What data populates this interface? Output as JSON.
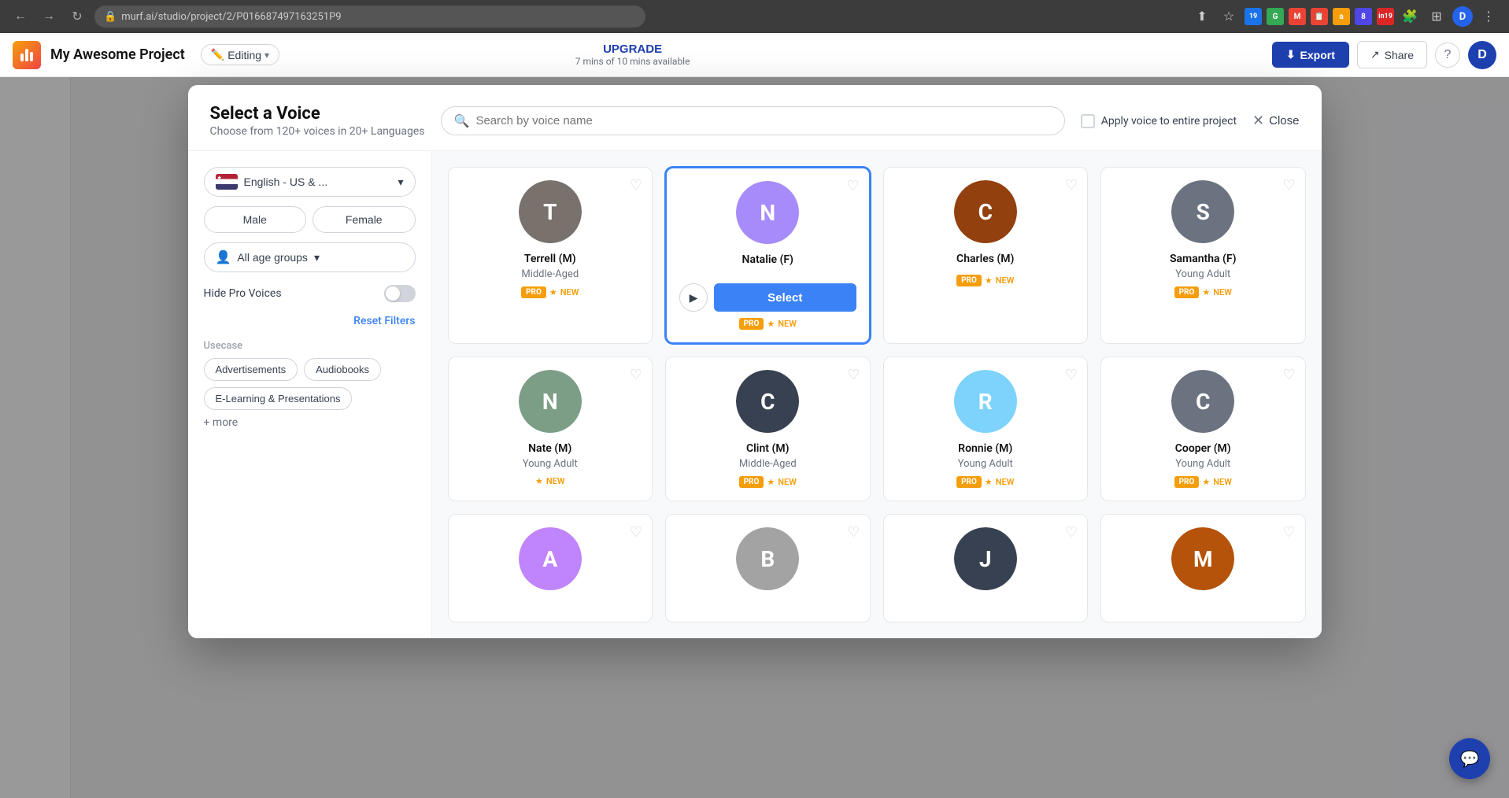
{
  "browser": {
    "url": "murf.ai/studio/project/2/P016687497163251P9",
    "back_label": "←",
    "forward_label": "→",
    "reload_label": "↺",
    "user_label": "D"
  },
  "app": {
    "logo_alt": "Murf Logo",
    "project_name": "My Awesome Project",
    "editing_label": "Editing",
    "upgrade_label": "UPGRADE",
    "mins_label": "7 mins of 10 mins available",
    "export_label": "Export",
    "share_label": "Share",
    "user_initial": "D"
  },
  "modal": {
    "title": "Select a Voice",
    "subtitle": "Choose from 120+ voices in 20+ Languages",
    "search_placeholder": "Search by voice name",
    "apply_label": "Apply voice to entire project",
    "close_label": "Close",
    "language": {
      "label": "English - US & ...",
      "dropdown_icon": "▾"
    },
    "gender": {
      "male_label": "Male",
      "female_label": "Female"
    },
    "age": {
      "label": "All age groups",
      "dropdown_icon": "▾"
    },
    "hide_pro_label": "Hide Pro Voices",
    "reset_label": "Reset Filters",
    "usecase_label": "Usecase",
    "usecase_tags": [
      "Advertisements",
      "Audiobooks",
      "E-Learning & Presentations"
    ],
    "more_label": "+ more",
    "voices": [
      {
        "name": "Terrell (M)",
        "age": "Middle-Aged",
        "tags": [
          "PRO",
          "NEW"
        ],
        "selected": false,
        "avatar_color": "#78716c",
        "avatar_letter": "T"
      },
      {
        "name": "Natalie (F)",
        "age": "",
        "tags": [
          "PRO",
          "NEW"
        ],
        "selected": true,
        "avatar_color": "#a78bfa",
        "avatar_letter": "N"
      },
      {
        "name": "Charles (M)",
        "age": "",
        "tags": [
          "PRO",
          "NEW"
        ],
        "selected": false,
        "avatar_color": "#92400e",
        "avatar_letter": "C"
      },
      {
        "name": "Samantha (F)",
        "age": "Young Adult",
        "tags": [
          "PRO",
          "NEW"
        ],
        "selected": false,
        "avatar_color": "#6b7280",
        "avatar_letter": "S"
      },
      {
        "name": "Nate (M)",
        "age": "Young Adult",
        "tags": [
          "NEW"
        ],
        "selected": false,
        "avatar_color": "#7c9e87",
        "avatar_letter": "N"
      },
      {
        "name": "Clint (M)",
        "age": "Middle-Aged",
        "tags": [
          "PRO",
          "NEW"
        ],
        "selected": false,
        "avatar_color": "#374151",
        "avatar_letter": "C"
      },
      {
        "name": "Ronnie (M)",
        "age": "Young Adult",
        "tags": [
          "PRO",
          "NEW"
        ],
        "selected": false,
        "avatar_color": "#93c5fd",
        "avatar_letter": "R"
      },
      {
        "name": "Cooper (M)",
        "age": "Young Adult",
        "tags": [
          "PRO",
          "NEW"
        ],
        "selected": false,
        "avatar_color": "#6b7280",
        "avatar_letter": "C"
      },
      {
        "name": "",
        "age": "",
        "tags": [],
        "selected": false,
        "avatar_color": "#c084fc",
        "avatar_letter": "A"
      },
      {
        "name": "",
        "age": "",
        "tags": [],
        "selected": false,
        "avatar_color": "#a3a3a3",
        "avatar_letter": "B"
      },
      {
        "name": "",
        "age": "",
        "tags": [],
        "selected": false,
        "avatar_color": "#374151",
        "avatar_letter": "J"
      },
      {
        "name": "",
        "age": "",
        "tags": [],
        "selected": false,
        "avatar_color": "#b45309",
        "avatar_letter": "M"
      }
    ],
    "select_button_label": "Select",
    "play_button_label": "▶"
  }
}
